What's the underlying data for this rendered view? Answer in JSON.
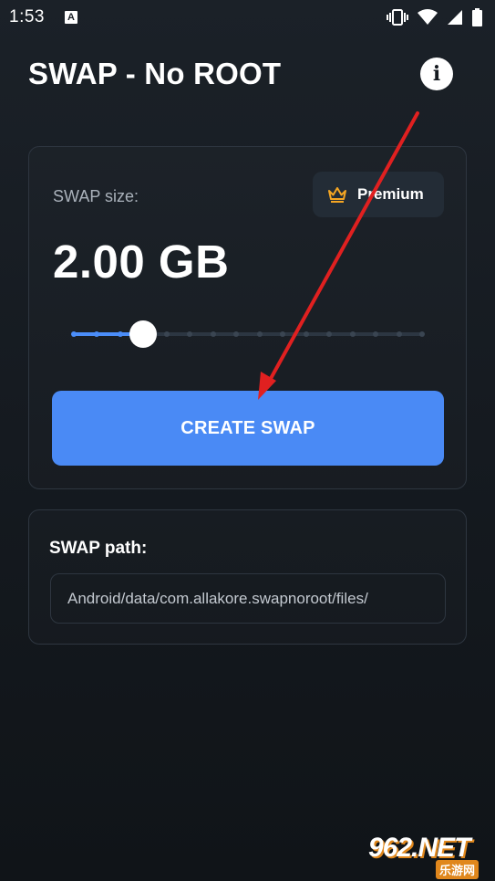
{
  "status_bar": {
    "time": "1:53",
    "notification_icon": "a-icon",
    "icons": [
      "vibrate-icon",
      "wifi-icon",
      "signal-icon",
      "battery-icon"
    ]
  },
  "header": {
    "title": "SWAP - No ROOT",
    "info_icon": "info-icon"
  },
  "swap_card": {
    "size_label": "SWAP size:",
    "premium_label": "Premium",
    "premium_icon": "crown-icon",
    "size_value": "2.00 GB",
    "slider": {
      "steps": 16,
      "selected_index": 3,
      "fraction": 0.2
    },
    "create_button_label": "CREATE SWAP"
  },
  "path_card": {
    "label": "SWAP path:",
    "value": "Android/data/com.allakore.swapnoroot/files/"
  },
  "watermark": {
    "main": "962.NET",
    "sub": "乐游网"
  },
  "colors": {
    "background": "#151a20",
    "accent": "#4a8af5",
    "card_border": "#2e3640",
    "premium_crown": "#f5a623",
    "annotation": "#e02020"
  }
}
